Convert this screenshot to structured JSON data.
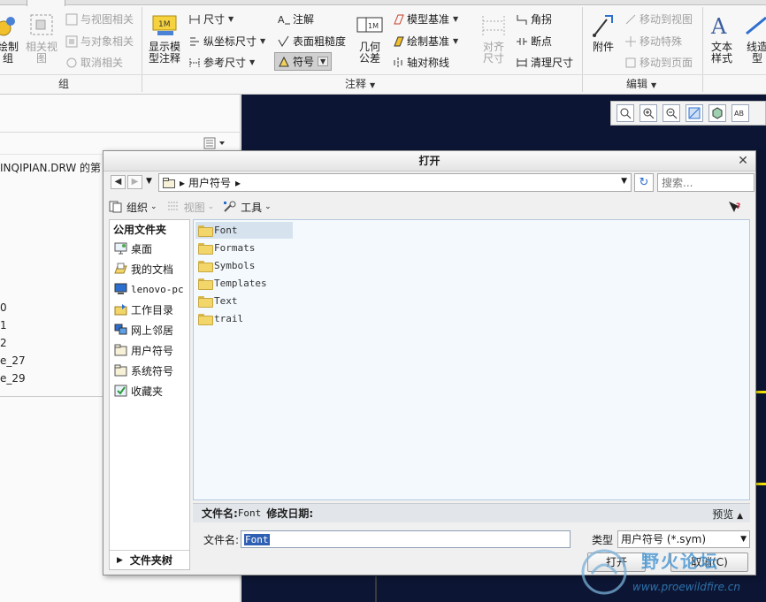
{
  "ribbon": {
    "group_btns": {
      "draw_group": "绘制\n组",
      "related_view": "相关视\n图",
      "with_view_related": "与视图相关",
      "with_object_related": "与对象相关",
      "cancel_related": "取消相关"
    },
    "annotation_btns": {
      "show_model_annotation": "显示模\n型注释",
      "dimension": "尺寸",
      "ordinate_dimension": "纵坐标尺寸",
      "reference_dimension": "参考尺寸",
      "note": "注解",
      "surface_finish": "表面粗糙度",
      "symbol": "符号",
      "geometric_tolerance": "几何\n公差",
      "model_datum": "模型基准",
      "draw_datum": "绘制基准",
      "axis_symmetric": "轴对称线",
      "align_dimension": "对齐\n尺寸",
      "jog": "角拐",
      "breakpoint": "断点",
      "cleanup_dimension": "清理尺寸"
    },
    "edit_btns": {
      "attachment": "附件",
      "move_to_view": "移动到视图",
      "move_special": "移动特殊",
      "move_to_page": "移动到页面"
    },
    "format_btns": {
      "text_style": "文本\n样式",
      "line_style": "线造\n型"
    },
    "groups": {
      "group": "组",
      "annotation": "注释",
      "edit": "编辑"
    }
  },
  "left_panel": {
    "drawing_name": "INQIPIAN.DRW 的第",
    "items": [
      "0",
      "1",
      "2",
      "e_27",
      "e_29"
    ]
  },
  "dialog": {
    "title": "打开",
    "address": {
      "path": "用户符号",
      "separator": "▸"
    },
    "search_placeholder": "搜索...",
    "commands": {
      "organize": "组织",
      "view": "视图",
      "tools": "工具"
    },
    "sidebar": {
      "header": "公用文件夹",
      "items": [
        {
          "label": "桌面",
          "icon": "desktop-icon"
        },
        {
          "label": "我的文档",
          "icon": "documents-icon"
        },
        {
          "label": "lenovo-pc",
          "icon": "computer-icon"
        },
        {
          "label": "工作目录",
          "icon": "work-dir-icon"
        },
        {
          "label": "网上邻居",
          "icon": "network-icon"
        },
        {
          "label": "用户符号",
          "icon": "user-symbol-icon"
        },
        {
          "label": "系统符号",
          "icon": "system-symbol-icon"
        },
        {
          "label": "收藏夹",
          "icon": "favorites-icon"
        }
      ],
      "footer": "文件夹树"
    },
    "files": [
      "Font",
      "Formats",
      "Symbols",
      "Templates",
      "Text",
      "trail"
    ],
    "selected_file": "Font",
    "info": {
      "name_label": "文件名:",
      "name_value": "Font",
      "modified_label": "修改日期:",
      "preview": "预览"
    },
    "filename_label": "文件名:",
    "filename_value": "Font",
    "type_label": "类型",
    "type_value": "用户符号 (*.sym)",
    "open_button": "打开",
    "cancel_button": "取消(C)"
  },
  "watermark": {
    "text": "野火论坛",
    "url": "www.proewildfire.cn"
  },
  "colors": {
    "canvas_bg": "#0c1634",
    "selection": "#d6e3ee",
    "highlight": "#2f5fb3",
    "datum_line": "#f5e400"
  }
}
